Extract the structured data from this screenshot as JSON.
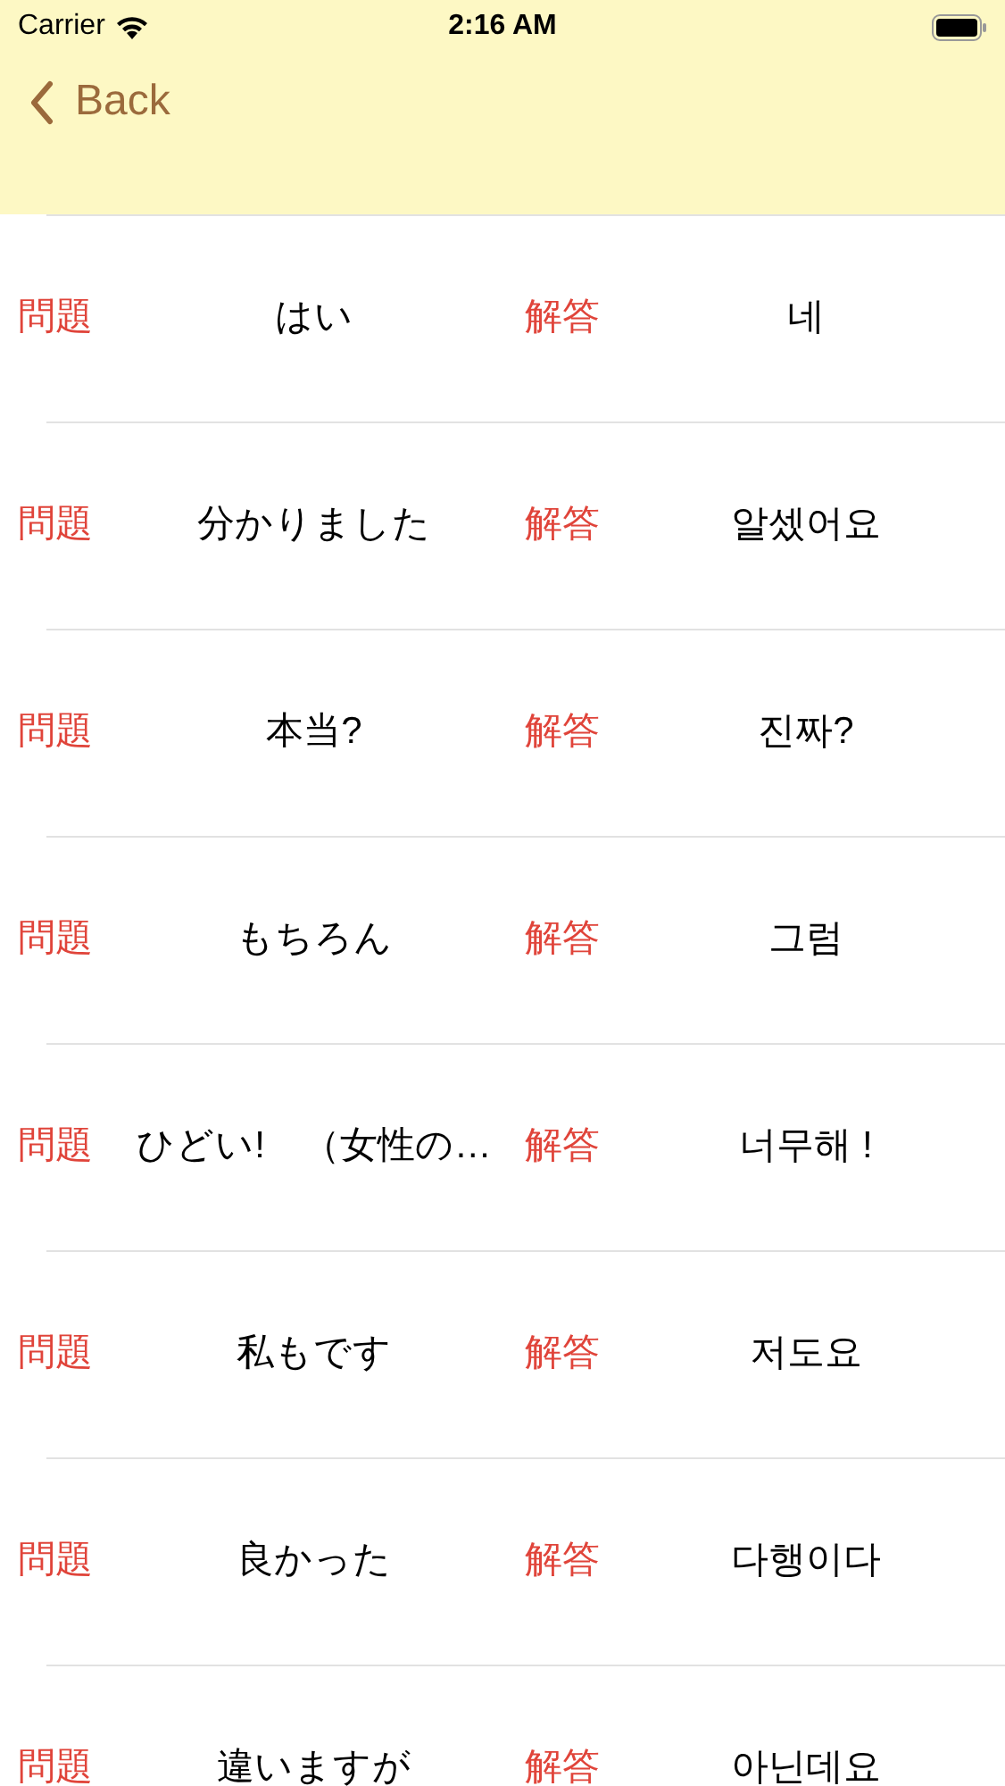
{
  "status_bar": {
    "carrier": "Carrier",
    "time": "2:16 AM"
  },
  "nav": {
    "back": "Back"
  },
  "rows": [
    {
      "question_label": "問題",
      "question": "はい",
      "answer_label": "解答",
      "answer": "네"
    },
    {
      "question_label": "問題",
      "question": "分かりました",
      "answer_label": "解答",
      "answer": "알셌어요"
    },
    {
      "question_label": "問題",
      "question": "本当?",
      "answer_label": "解答",
      "answer": "진짜?"
    },
    {
      "question_label": "問題",
      "question": "もちろん",
      "answer_label": "解答",
      "answer": "그럼"
    },
    {
      "question_label": "問題",
      "question": "ひどい!　（女性の…",
      "answer_label": "解答",
      "answer": "너무해 !"
    },
    {
      "question_label": "問題",
      "question": "私もです",
      "answer_label": "解答",
      "answer": "저도요"
    },
    {
      "question_label": "問題",
      "question": "良かった",
      "answer_label": "解答",
      "answer": "다행이다"
    },
    {
      "question_label": "問題",
      "question": "違いますが",
      "answer_label": "解答",
      "answer": "아닌데요"
    }
  ]
}
